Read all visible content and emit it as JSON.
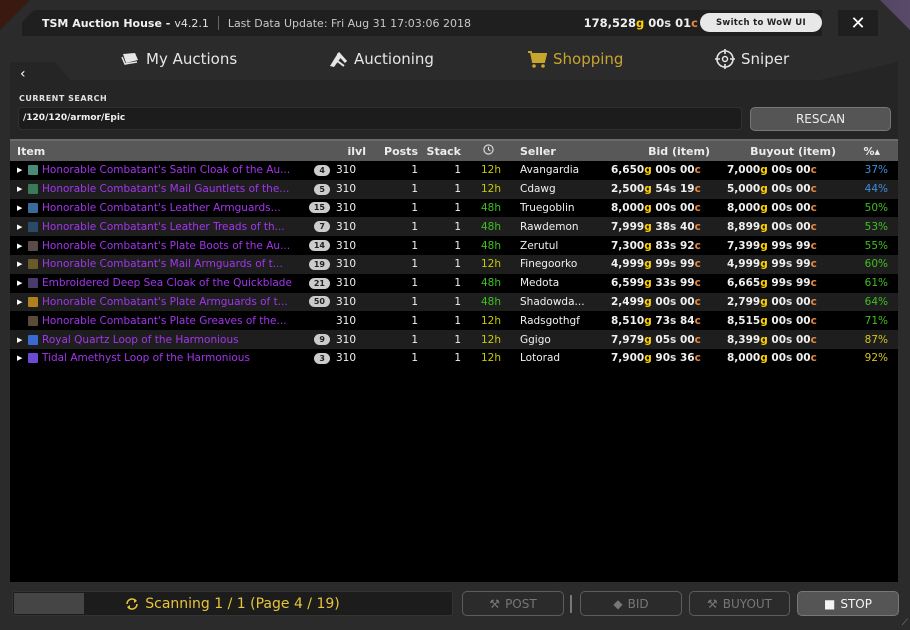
{
  "titlebar": {
    "app_name": "TSM Auction House -",
    "version": "v4.2.1",
    "last_update": "Last Data Update: Fri Aug 31 17:03:06 2018",
    "gold": {
      "g": "178,528",
      "s": "00",
      "c": "01"
    },
    "switch_label": "Switch to WoW UI",
    "close_label": "✕"
  },
  "nav": {
    "back": "‹",
    "tabs": [
      {
        "label": "My Auctions",
        "icon": "auctions-icon",
        "active": false
      },
      {
        "label": "Auctioning",
        "icon": "gavel-icon",
        "active": false
      },
      {
        "label": "Shopping",
        "icon": "cart-icon",
        "active": true
      },
      {
        "label": "Sniper",
        "icon": "crosshair-icon",
        "active": false
      }
    ]
  },
  "search": {
    "label": "CURRENT SEARCH",
    "value": "/120/120/armor/Epic",
    "rescan_label": "RESCAN"
  },
  "table": {
    "headers": {
      "item": "Item",
      "ilvl": "ilvl",
      "posts": "Posts",
      "stack": "Stack",
      "time": "clock-icon",
      "seller": "Seller",
      "bid": "Bid (item)",
      "buyout": "Buyout (item)",
      "pct": "%▴"
    },
    "rows": [
      {
        "expand": true,
        "name": "Honorable Combatant's Satin Cloak of the Au...",
        "icon_color": "#4a8a7a",
        "count": "4",
        "ilvl": "310",
        "posts": "1",
        "stack": "1",
        "time": "12h",
        "seller": "Avangardia",
        "bid": {
          "g": "6,650",
          "s": "00",
          "c": "00"
        },
        "buyout": {
          "g": "7,000",
          "s": "00",
          "c": "00"
        },
        "pct": "37%",
        "pct_class": "p-blue"
      },
      {
        "expand": true,
        "name": "Honorable Combatant's Mail Gauntlets of the...",
        "icon_color": "#3a7a5a",
        "count": "5",
        "ilvl": "310",
        "posts": "1",
        "stack": "1",
        "time": "12h",
        "seller": "Cdawg",
        "bid": {
          "g": "2,500",
          "s": "54",
          "c": "19"
        },
        "buyout": {
          "g": "5,000",
          "s": "00",
          "c": "00"
        },
        "pct": "44%",
        "pct_class": "p-blue"
      },
      {
        "expand": true,
        "name": "Honorable Combatant's Leather Armguards...",
        "icon_color": "#3a6a9a",
        "count": "15",
        "ilvl": "310",
        "posts": "1",
        "stack": "1",
        "time": "48h",
        "seller": "Truegoblin",
        "bid": {
          "g": "8,000",
          "s": "00",
          "c": "00"
        },
        "buyout": {
          "g": "8,000",
          "s": "00",
          "c": "00"
        },
        "pct": "50%",
        "pct_class": "p-green"
      },
      {
        "expand": true,
        "name": "Honorable Combatant's Leather Treads of th...",
        "icon_color": "#2a4a6a",
        "count": "7",
        "ilvl": "310",
        "posts": "1",
        "stack": "1",
        "time": "48h",
        "seller": "Rawdemon",
        "bid": {
          "g": "7,999",
          "s": "38",
          "c": "40"
        },
        "buyout": {
          "g": "8,899",
          "s": "00",
          "c": "00"
        },
        "pct": "53%",
        "pct_class": "p-green"
      },
      {
        "expand": true,
        "name": "Honorable Combatant's Plate Boots of the Au...",
        "icon_color": "#5a4a4a",
        "count": "14",
        "ilvl": "310",
        "posts": "1",
        "stack": "1",
        "time": "48h",
        "seller": "Zerutul",
        "bid": {
          "g": "7,300",
          "s": "83",
          "c": "92"
        },
        "buyout": {
          "g": "7,399",
          "s": "99",
          "c": "99"
        },
        "pct": "55%",
        "pct_class": "p-green"
      },
      {
        "expand": true,
        "name": "Honorable Combatant's Mail Armguards of t...",
        "icon_color": "#6a5a2a",
        "count": "19",
        "ilvl": "310",
        "posts": "1",
        "stack": "1",
        "time": "12h",
        "seller": "Finegoorko",
        "bid": {
          "g": "4,999",
          "s": "99",
          "c": "99"
        },
        "buyout": {
          "g": "4,999",
          "s": "99",
          "c": "99"
        },
        "pct": "60%",
        "pct_class": "p-green"
      },
      {
        "expand": true,
        "name": "Embroidered Deep Sea Cloak of the Quickblade",
        "icon_color": "#4a3a6a",
        "count": "21",
        "ilvl": "310",
        "posts": "1",
        "stack": "1",
        "time": "48h",
        "seller": "Medota",
        "bid": {
          "g": "6,599",
          "s": "33",
          "c": "99"
        },
        "buyout": {
          "g": "6,665",
          "s": "99",
          "c": "99"
        },
        "pct": "61%",
        "pct_class": "p-green"
      },
      {
        "expand": true,
        "name": "Honorable Combatant's Plate Armguards of t...",
        "icon_color": "#b08020",
        "count": "50",
        "ilvl": "310",
        "posts": "1",
        "stack": "1",
        "time": "48h",
        "seller": "Shadowda...",
        "bid": {
          "g": "2,499",
          "s": "00",
          "c": "00"
        },
        "buyout": {
          "g": "2,799",
          "s": "00",
          "c": "00"
        },
        "pct": "64%",
        "pct_class": "p-green"
      },
      {
        "expand": false,
        "name": "Honorable Combatant's Plate Greaves of the...",
        "icon_color": "#5a4a3a",
        "count": "",
        "ilvl": "310",
        "posts": "1",
        "stack": "1",
        "time": "12h",
        "seller": "Radsgothgf",
        "bid": {
          "g": "8,510",
          "s": "73",
          "c": "84"
        },
        "buyout": {
          "g": "8,515",
          "s": "00",
          "c": "00"
        },
        "pct": "71%",
        "pct_class": "p-green"
      },
      {
        "expand": true,
        "name": "Royal Quartz Loop of the Harmonious",
        "icon_color": "#3a6ad0",
        "count": "9",
        "ilvl": "310",
        "posts": "1",
        "stack": "1",
        "time": "12h",
        "seller": "Ggigo",
        "bid": {
          "g": "7,979",
          "s": "05",
          "c": "00"
        },
        "buyout": {
          "g": "8,399",
          "s": "00",
          "c": "00"
        },
        "pct": "87%",
        "pct_class": "p-yellow"
      },
      {
        "expand": true,
        "name": "Tidal Amethyst Loop of the Harmonious",
        "icon_color": "#6a4ad0",
        "count": "3",
        "ilvl": "310",
        "posts": "1",
        "stack": "1",
        "time": "12h",
        "seller": "Lotorad",
        "bid": {
          "g": "7,900",
          "s": "90",
          "c": "36"
        },
        "buyout": {
          "g": "8,000",
          "s": "00",
          "c": "00"
        },
        "pct": "92%",
        "pct_class": "p-yellow"
      }
    ]
  },
  "footer": {
    "scan_text": "Scanning 1 / 1 (Page 4 / 19)",
    "progress_fraction": 0.16,
    "post_label": "POST",
    "bid_label": "BID",
    "buyout_label": "BUYOUT",
    "stop_label": "STOP"
  },
  "colors": {
    "epic": "#a335ee",
    "accent_active": "#c8a52e",
    "scan_text": "#e8c43a",
    "gold": "#ffd100",
    "copper": "#e8883a"
  }
}
